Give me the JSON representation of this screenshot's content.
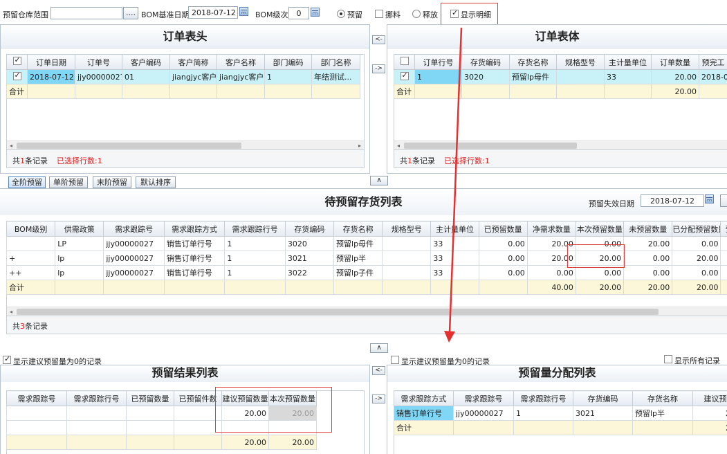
{
  "toolbar": {
    "warehouse_label": "预留仓库范围",
    "warehouse_value": "",
    "browse_label": "....",
    "bom_date_label": "BOM基准日期",
    "bom_date_value": "2018-07-12",
    "bom_level_label": "BOM级次",
    "bom_level_value": "0",
    "radio_reserve": "预留",
    "check_nuo": "挪料",
    "radio_release": "释放",
    "check_detail": "显示明细"
  },
  "order_head": {
    "title": "订单表头",
    "columns": [
      "订单日期",
      "订单号",
      "客户编码",
      "客户简称",
      "客户名称",
      "部门编码",
      "部门名称"
    ],
    "rows": [
      [
        "2018-07-12",
        "jjy00000027",
        "01",
        "jiangjyc客户",
        "jiangjyc客户",
        "1",
        "年结测试..."
      ]
    ],
    "sum_label": "合计",
    "status_prefix": "共",
    "status_count": "1",
    "status_suffix": "条记录",
    "status_selected": "已选择行数:1"
  },
  "transfer": {
    "left": "<-",
    "right": "->"
  },
  "order_body": {
    "title": "订单表体",
    "columns": [
      "订单行号",
      "存货编码",
      "存货名称",
      "规格型号",
      "主计量单位",
      "订单数量",
      "预完工"
    ],
    "rows": [
      [
        "1",
        "3020",
        "预留lp母件",
        "",
        "33",
        "20.00",
        "2018-07"
      ]
    ],
    "sum_label": "合计",
    "sum_qty": "20.00",
    "status_prefix": "共",
    "status_count": "1",
    "status_suffix": "条记录",
    "status_selected": "已选择行数:1"
  },
  "level_tabs": [
    "全阶预留",
    "单阶预留",
    "末阶预留",
    "默认排序"
  ],
  "collapse_glyph": "∧",
  "pending": {
    "title": "待预留存货列表",
    "expire_label": "预留失效日期",
    "expire_value": "2018-07-12",
    "columns": [
      "BOM级别",
      "供需政策",
      "需求跟踪号",
      "需求跟踪方式",
      "需求跟踪行号",
      "存货编码",
      "存货名称",
      "规格型号",
      "主计量单位",
      "已预留数量",
      "净需求数量",
      "本次预留数量",
      "未预留数量",
      "已分配预留数量",
      "预"
    ],
    "rows": [
      [
        "",
        "LP",
        "jjy00000027",
        "销售订单行号",
        "1",
        "3020",
        "预留lp母件",
        "",
        "33",
        "0.00",
        "20.00",
        "0.00",
        "20.00",
        "0.00",
        ""
      ],
      [
        "+",
        "lp",
        "jjy00000027",
        "销售订单行号",
        "1",
        "3021",
        "预留lp半",
        "",
        "33",
        "0.00",
        "20.00",
        "20.00",
        "0.00",
        "20.00",
        ""
      ],
      [
        "++",
        "lp",
        "jjy00000027",
        "销售订单行号",
        "1",
        "3022",
        "预留lp子件",
        "",
        "33",
        "0.00",
        "0.00",
        "0.00",
        "0.00",
        "0.00",
        ""
      ]
    ],
    "sum_label": "合计",
    "sum_values": [
      "",
      "",
      "",
      "",
      "",
      "",
      "",
      "",
      "",
      "",
      "40.00",
      "20.00",
      "20.00",
      "20.00",
      ""
    ],
    "status_prefix": "共",
    "status_count": "3",
    "status_suffix": "条记录"
  },
  "result": {
    "show_zero_label": "显示建议预留量为0的记录",
    "title": "预留结果列表",
    "columns": [
      "需求跟踪号",
      "需求跟踪行号",
      "已预留数量",
      "已预留件数",
      "建议预留数量",
      "本次预留数量"
    ],
    "rows": [
      [
        "",
        "",
        "",
        "",
        "20.00",
        "20.00"
      ]
    ],
    "sum_values": [
      "",
      "",
      "",
      "",
      "20.00",
      "20.00"
    ]
  },
  "allocation": {
    "show_zero_label": "显示建议预留量为0的记录",
    "show_all_label": "显示所有记录",
    "title": "预留量分配列表",
    "columns": [
      "需求跟踪方式",
      "需求跟踪号",
      "需求跟踪行号",
      "存货编码",
      "存货名称",
      "建议预"
    ],
    "rows": [
      [
        "销售订单行号",
        "jjy00000027",
        "1",
        "3021",
        "预留lp半",
        "20"
      ]
    ],
    "sum_label": "合计",
    "sum_values": [
      "",
      "",
      "",
      "",
      "",
      "20"
    ]
  }
}
